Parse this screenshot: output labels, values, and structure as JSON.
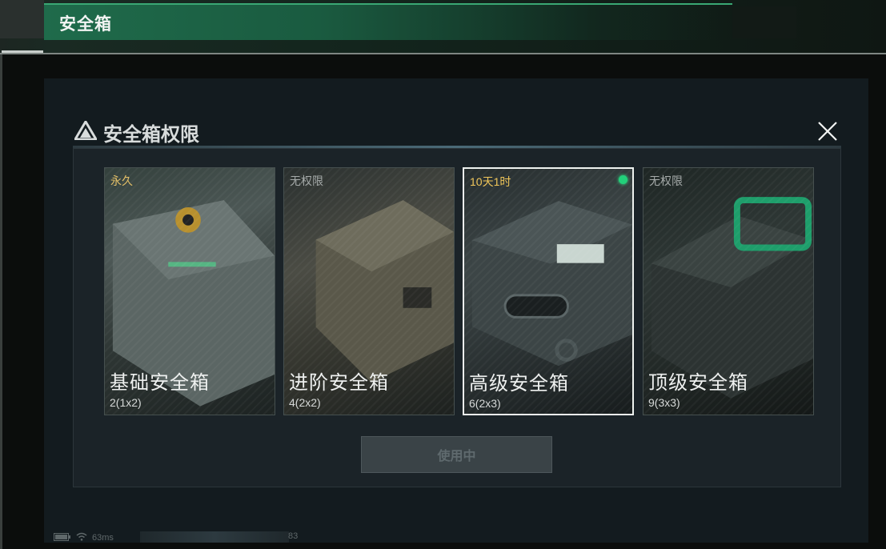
{
  "header": {
    "title": "安全箱"
  },
  "dialog": {
    "title": "安全箱权限",
    "cards": [
      {
        "status": "永久",
        "status_color": "#e4c068",
        "name": "基础安全箱",
        "size": "2(1x2)",
        "selected": false
      },
      {
        "status": "无权限",
        "status_color": "#a6abaa",
        "name": "进阶安全箱",
        "size": "4(2x2)",
        "selected": false
      },
      {
        "status": "10天1时",
        "status_color": "#f0c65a",
        "name": "高级安全箱",
        "size": "6(2x3)",
        "selected": true,
        "active": true
      },
      {
        "status": "无权限",
        "status_color": "#a6abaa",
        "name": "顶级安全箱",
        "size": "9(3x3)",
        "selected": false
      }
    ],
    "button_label": "使用中"
  },
  "footer": {
    "ping": "63ms",
    "value": "83"
  },
  "colors": {
    "accent_green": "#22d07a",
    "header_green": "#1f6b4b"
  },
  "icons": [
    "delta-logo-icon",
    "close-icon",
    "battery-icon",
    "wifi-icon"
  ]
}
